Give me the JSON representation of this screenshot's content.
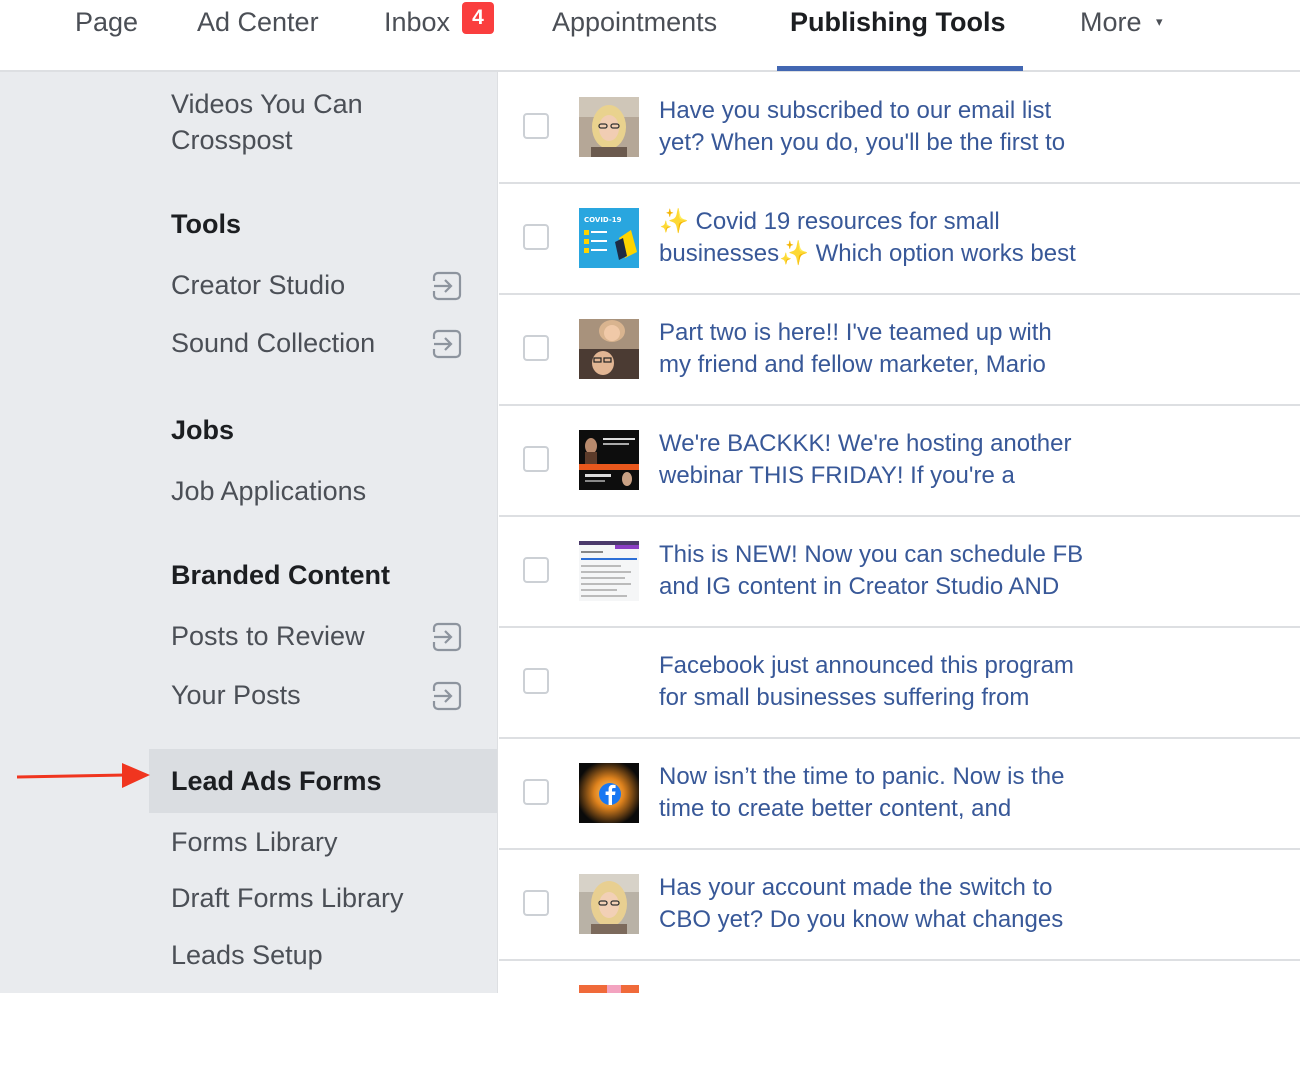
{
  "top_nav": {
    "tabs": [
      "Page",
      "Ad Center",
      "Inbox",
      "Appointments",
      "Publishing Tools",
      "More"
    ],
    "inbox_badge": "4",
    "active_tab": "Publishing Tools",
    "more_caret": "▾"
  },
  "sidebar": {
    "videos_crosspost": [
      "Videos You Can",
      "Crosspost"
    ],
    "tools_header": "Tools",
    "creator_studio": "Creator Studio",
    "sound_collection": "Sound Collection",
    "jobs_header": "Jobs",
    "job_applications": "Job Applications",
    "branded_header": "Branded Content",
    "posts_to_review": "Posts to Review",
    "your_posts": "Your Posts",
    "lead_ads_header": "Lead Ads Forms",
    "forms_library": "Forms Library",
    "draft_forms_library": "Draft Forms Library",
    "leads_setup": "Leads Setup",
    "external_link_icon": "external-link-icon"
  },
  "posts": [
    {
      "lines": [
        "Have you subscribed to our email list",
        "yet? When you do, you'll be the first to"
      ],
      "thumb": "woman-selfie"
    },
    {
      "lines": [
        "✨ Covid 19 resources for small",
        "businesses✨  Which option works best"
      ],
      "thumb": "covid-graphic",
      "thumb_text": "COVID-19"
    },
    {
      "lines": [
        "Part two is here!! I've teamed up with",
        "my friend and fellow marketer, Mario"
      ],
      "thumb": "two-people"
    },
    {
      "lines": [
        "We're BACKKK! We're hosting another",
        "webinar THIS FRIDAY! If you're a"
      ],
      "thumb": "webinar-banner"
    },
    {
      "lines": [
        "This is NEW! Now you can schedule FB",
        "and IG content in Creator Studio AND"
      ],
      "thumb": "screenshot"
    },
    {
      "lines": [
        "Facebook just announced this program",
        "for small businesses suffering from"
      ],
      "thumb": "none"
    },
    {
      "lines": [
        "Now isn’t the time to panic. Now is the",
        "time to create better content, and"
      ],
      "thumb": "facebook-logo"
    },
    {
      "lines": [
        "Has your account made the switch to",
        "CBO yet? Do you know what changes"
      ],
      "thumb": "woman-selfie"
    }
  ],
  "colors": {
    "link_blue": "#385898",
    "active_underline": "#4267b2",
    "sidebar_bg": "#e9ebee",
    "badge_red": "#fa3e3e",
    "arrow_red": "#f0351f"
  }
}
